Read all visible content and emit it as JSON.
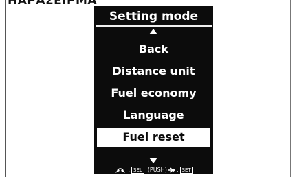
{
  "header": {
    "title": "ΗΑΡΑΣΕΙΡΜΑ"
  },
  "screen": {
    "title": "Setting mode",
    "menu": [
      {
        "label": "Back"
      },
      {
        "label": "Distance unit"
      },
      {
        "label": "Fuel economy"
      },
      {
        "label": "Language"
      },
      {
        "label": "Fuel reset"
      }
    ],
    "selected_index": 4,
    "hint": {
      "colon1": ":",
      "sel": "SEL",
      "push": "(PUSH)",
      "colon2": ":",
      "set": "SET"
    }
  },
  "icons": {
    "up": "arrow-up-icon",
    "down": "arrow-down-icon",
    "rotate": "rotate-knob-icon",
    "enter": "enter-arrow-icon"
  },
  "colors": {
    "screen_bg": "#0c0c0c",
    "text": "#ffffff",
    "selected_bg": "#ffffff"
  }
}
